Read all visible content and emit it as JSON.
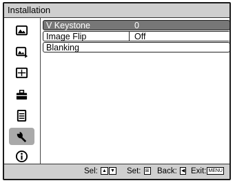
{
  "window": {
    "title": "Installation"
  },
  "sidebar": {
    "items": [
      {
        "icon": "picture-icon",
        "active": false
      },
      {
        "icon": "advanced-picture-icon",
        "active": false
      },
      {
        "icon": "screen-icon",
        "active": false
      },
      {
        "icon": "setup-icon",
        "active": false
      },
      {
        "icon": "menu-settings-icon",
        "active": false
      },
      {
        "icon": "wrench-icon",
        "active": true
      },
      {
        "icon": "information-icon",
        "active": false
      }
    ]
  },
  "menu": {
    "rows": [
      {
        "label": "V Keystone",
        "value": "0",
        "highlighted": true
      },
      {
        "label": "Image Flip",
        "value": "Off",
        "highlighted": false
      },
      {
        "label": "Blanking",
        "value": "",
        "highlighted": false
      }
    ]
  },
  "footer": {
    "sel_label": "Sel:",
    "set_label": "Set:",
    "back_label": "Back:",
    "exit_label": "Exit:",
    "exit_key": "MENU"
  }
}
